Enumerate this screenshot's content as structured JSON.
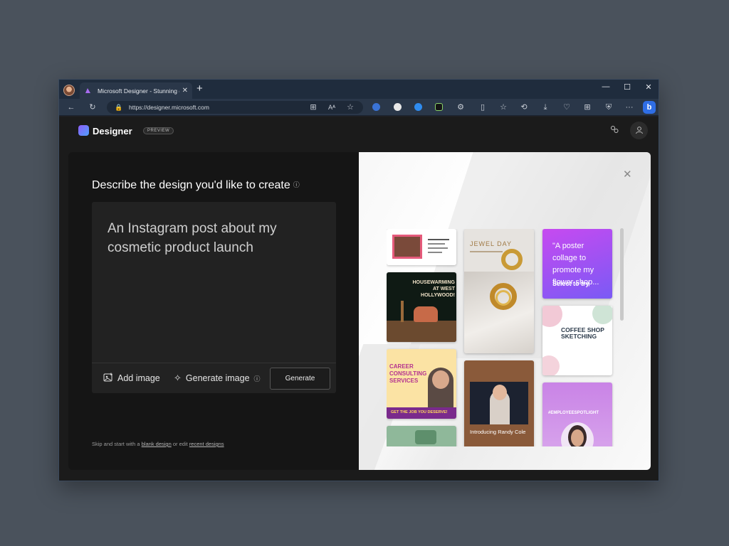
{
  "browser": {
    "tab_title": "Microsoft Designer - Stunning d",
    "tab_close": "✕",
    "new_tab": "+",
    "url": "https://designer.microsoft.com",
    "window_controls": {
      "minimize": "—",
      "maximize": "☐",
      "close": "✕"
    }
  },
  "app": {
    "name": "Designer",
    "badge": "PREVIEW"
  },
  "left": {
    "title": "Describe the design you'd like to create",
    "info": "ⓘ",
    "prompt": "An Instagram post about my cosmetic product launch",
    "add_image": "Add image",
    "generate_image": "Generate image",
    "generate": "Generate",
    "skip_prefix": "Skip and start with a",
    "blank_design": "blank design",
    "skip_middle": "or edit",
    "recent_designs": "recent designs"
  },
  "right": {
    "close": "✕",
    "cards": {
      "housewarming": "HOUSEWARMING AT WEST HOLLYWOOD!",
      "jewel_title": "JEWEL DAY",
      "poster_quote": "\"A poster collage to promote my flower shop...",
      "select_to_try": "Select to try",
      "coffee": "COFFEE SHOP SKETCHING",
      "career": "CAREER CONSULTING SERVICES",
      "career_cta": "GET THE JOB YOU DESERVE!",
      "randy": "Introducing Randy Cole",
      "spotlight": "#EMPLOYEESPOTLIGHT"
    }
  },
  "colors": {
    "accent_purple": "#a86cf0",
    "career_purple": "#7a2a8c",
    "career_yellow": "#f5c43a"
  }
}
